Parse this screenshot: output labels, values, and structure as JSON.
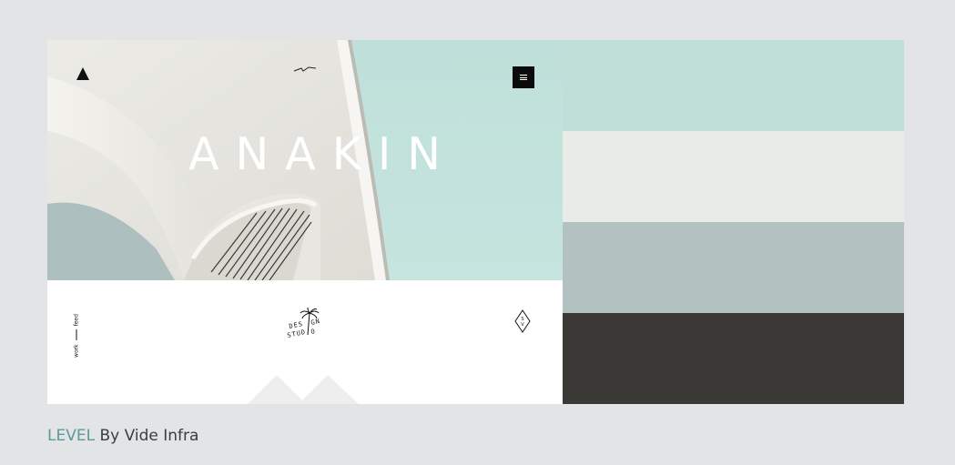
{
  "hero": {
    "title": "ANAKIN"
  },
  "side_nav": {
    "item_1": "work",
    "item_2": "feed"
  },
  "studio_mark": {
    "text_line_1": "DESIGN",
    "text_line_2": "STUDIO",
    "icon": "palm-tree-icon"
  },
  "icons": {
    "logo": "triangle-logo-icon",
    "squiggle": "signature-squiggle-icon",
    "menu": "hamburger-menu-icon",
    "badge": "diamond-badge-icon"
  },
  "palette": {
    "colors": [
      "#c1dfd9",
      "#e9ebe6",
      "#b1c2c0",
      "#3a3935"
    ]
  },
  "caption": {
    "highlight": "LEVEL",
    "rest": " By Vide Infra"
  },
  "theme": {
    "accent": "#5c9a98",
    "background": "#e3e4e6"
  }
}
